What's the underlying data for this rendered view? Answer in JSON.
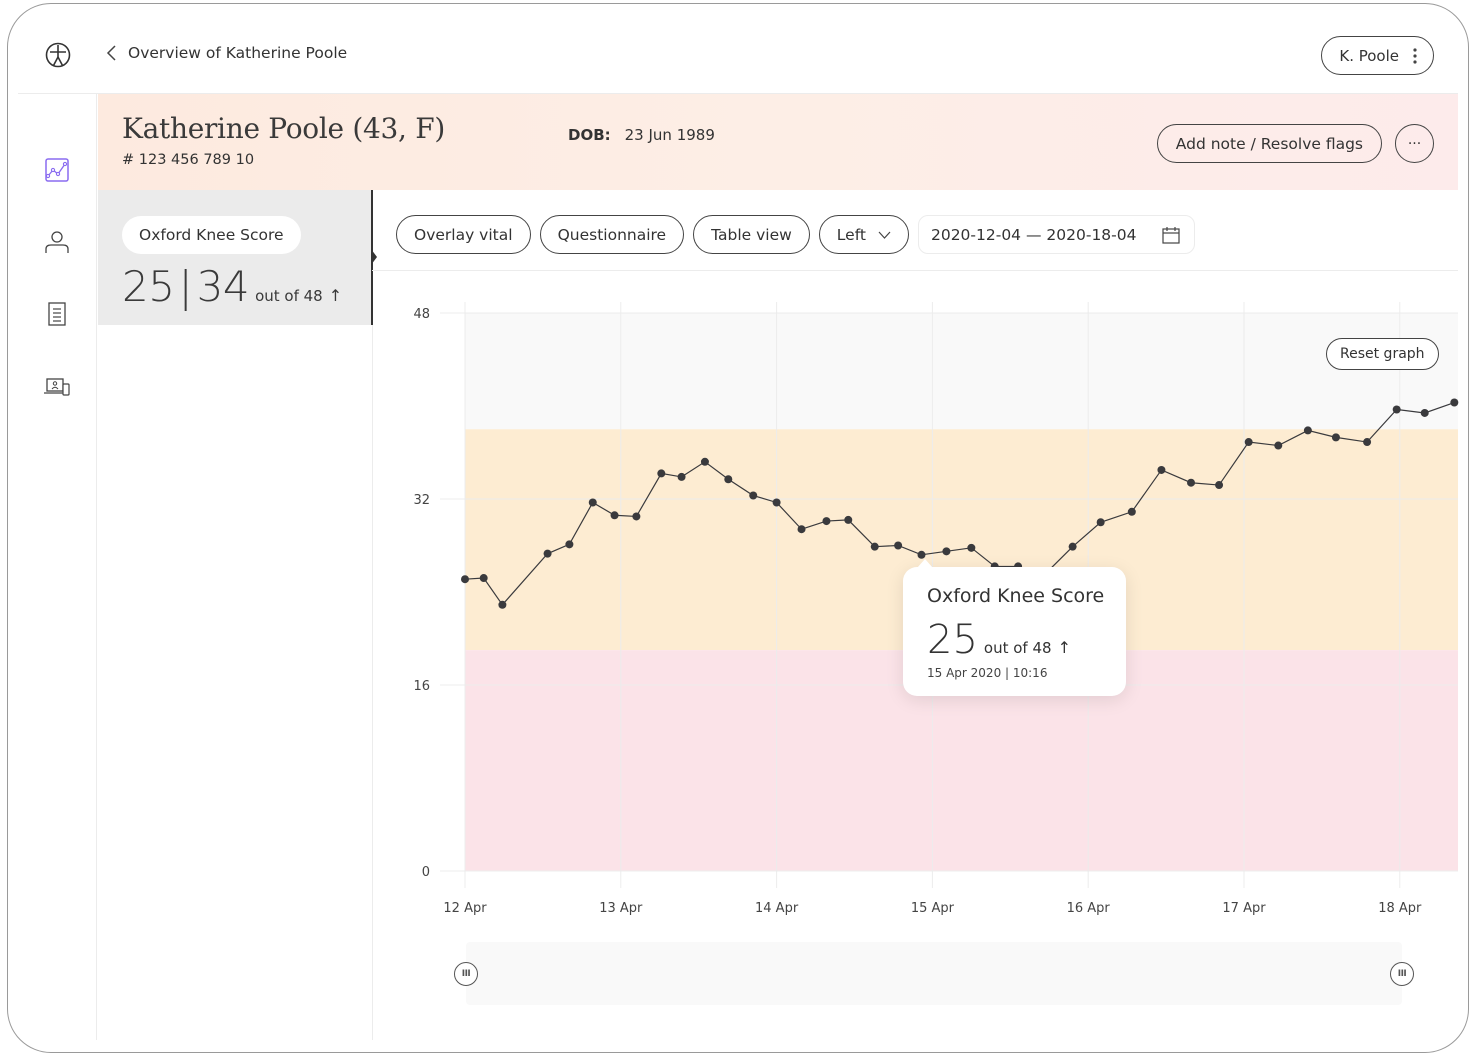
{
  "topbar": {
    "back_label": "Overview of Katherine Poole",
    "user_label": "K. Poole"
  },
  "nav": {
    "items": [
      {
        "id": "graphs",
        "icon": "chart-line-icon",
        "active": true
      },
      {
        "id": "profile",
        "icon": "person-icon",
        "active": false
      },
      {
        "id": "documents",
        "icon": "document-icon",
        "active": false
      },
      {
        "id": "devices",
        "icon": "devices-icon",
        "active": false
      }
    ],
    "active_color": "#8a6cf0"
  },
  "patient": {
    "name": "Katherine Poole (43,  F)",
    "id": "# 123 456 789 10",
    "dob_label": "DOB:",
    "dob_value": "23 Jun 1989",
    "add_note_label": "Add note / Resolve flags",
    "more_label": "···"
  },
  "score_card": {
    "title": "Oxford Knee Score",
    "previous": "25",
    "current": "34",
    "max_label": "out of 48",
    "trend": "↑"
  },
  "toolbar": {
    "overlay_label": "Overlay vital",
    "questionnaire_label": "Questionnaire",
    "table_label": "Table view",
    "side_label": "Left",
    "date_range": "2020-12-04 — 2020-18-04"
  },
  "reset_label": "Reset graph",
  "tooltip": {
    "title": "Oxford Knee Score",
    "value": "25",
    "max_label": "out of 48",
    "trend": "↑",
    "datetime": "15 Apr 2020 | 10:16"
  },
  "slider": {
    "handle_glyph": "III",
    "range_start": 0,
    "range_end": 1
  },
  "chart_data": {
    "type": "line",
    "title": "Oxford Knee Score",
    "xlabel": "",
    "ylabel": "",
    "ylim": [
      0,
      48
    ],
    "yticks": [
      0,
      16,
      32,
      48
    ],
    "xlim_days": [
      0,
      6.4
    ],
    "xticks": [
      {
        "day": 0,
        "label": "12 Apr"
      },
      {
        "day": 1,
        "label": "13 Apr"
      },
      {
        "day": 2,
        "label": "14 Apr"
      },
      {
        "day": 3,
        "label": "15 Apr"
      },
      {
        "day": 4,
        "label": "16 Apr"
      },
      {
        "day": 5,
        "label": "17 Apr"
      },
      {
        "day": 6,
        "label": "18 Apr"
      }
    ],
    "grid": true,
    "bands": [
      {
        "from": 38,
        "to": 48,
        "color": "#f9f9f9",
        "name": "normal"
      },
      {
        "from": 19,
        "to": 38,
        "color": "#fdecd2",
        "name": "warning"
      },
      {
        "from": 0,
        "to": 19,
        "color": "#fbe3e8",
        "name": "alert"
      }
    ],
    "series": [
      {
        "name": "Oxford Knee Score",
        "color": "#3a3a3d",
        "x_days": [
          0.0,
          0.12,
          0.24,
          0.53,
          0.67,
          0.82,
          0.96,
          1.1,
          1.26,
          1.39,
          1.54,
          1.69,
          1.85,
          2.0,
          2.16,
          2.32,
          2.46,
          2.63,
          2.78,
          2.93,
          3.09,
          3.25,
          3.4,
          3.55,
          3.72,
          3.9,
          4.08,
          4.28,
          4.47,
          4.66,
          4.84,
          5.03,
          5.22,
          5.41,
          5.59,
          5.79,
          5.98,
          6.16,
          6.35
        ],
        "values": [
          25.1,
          25.2,
          22.9,
          27.3,
          28.1,
          31.7,
          30.6,
          30.5,
          34.2,
          33.9,
          35.2,
          33.7,
          32.3,
          31.7,
          29.4,
          30.1,
          30.2,
          27.9,
          28.0,
          27.2,
          27.5,
          27.8,
          26.2,
          26.2,
          25.5,
          27.9,
          30.0,
          30.9,
          34.5,
          33.4,
          33.2,
          36.9,
          36.6,
          37.9,
          37.3,
          36.9,
          39.7,
          39.4,
          40.3
        ]
      }
    ]
  }
}
